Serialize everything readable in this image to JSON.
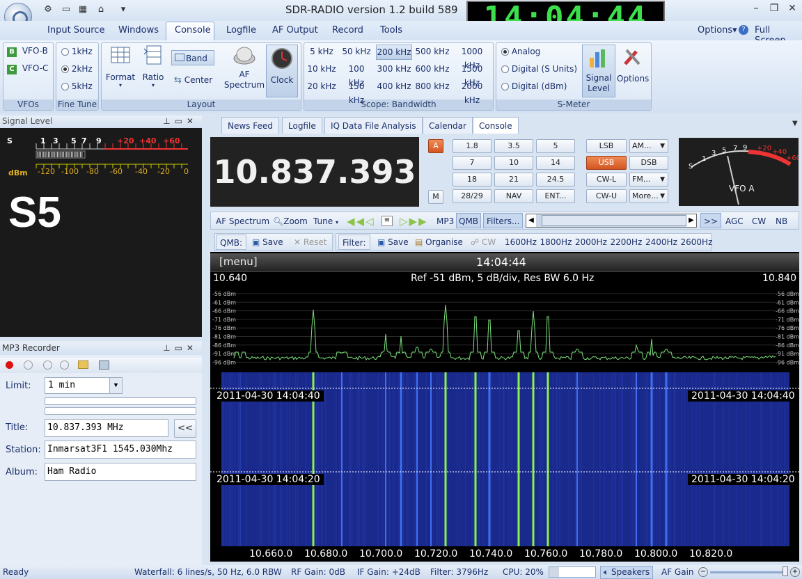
{
  "app": {
    "title": "SDR-RADIO version 1.2  build 589",
    "clock": "14:04:44"
  },
  "menu": {
    "items": [
      "Input Source",
      "Windows",
      "Console",
      "Logfile",
      "AF Output",
      "Record",
      "Tools"
    ],
    "options": "Options",
    "fullscreen": "Full Screen"
  },
  "ribbon": {
    "vfo": {
      "b": "VFO-B",
      "c": "VFO-C",
      "caption": "VFOs"
    },
    "finetune": {
      "options": [
        "1kHz",
        "2kHz",
        "5kHz"
      ],
      "selected": "2kHz",
      "caption": "Fine Tune"
    },
    "layout": {
      "format": "Format",
      "ratio": "Ratio",
      "band": "Band",
      "center": "Center",
      "af": "AF Spectrum",
      "clock": "Clock",
      "caption": "Layout"
    },
    "bandwidth": {
      "items": [
        "5 kHz",
        "50 kHz",
        "200 kHz",
        "500 kHz",
        "1000 kHz",
        "10 kHz",
        "100 kHz",
        "300 kHz",
        "600 kHz",
        "1500 kHz",
        "20 kHz",
        "150 kHz",
        "400 kHz",
        "800 kHz",
        "2000 kHz"
      ],
      "selected": "200 kHz",
      "caption": "Scope: Bandwidth"
    },
    "smeter": {
      "options": [
        "Analog",
        "Digital (S Units)",
        "Digital (dBm)"
      ],
      "selected": "Analog",
      "signal": "Signal Level",
      "opts": "Options",
      "caption": "S-Meter"
    }
  },
  "signal_panel": {
    "title": "Signal Level",
    "reading": "S5",
    "units": "dBm",
    "s_scale": [
      "S",
      "1",
      "3",
      "5",
      "7",
      "9",
      "+20",
      "+40",
      "+60"
    ],
    "dbm_scale": [
      "-120",
      "-100",
      "-80",
      "-60",
      "-40",
      "-20",
      "0"
    ]
  },
  "mp3": {
    "title": "MP3 Recorder",
    "limit_label": "Limit:",
    "limit": "1 min",
    "title_label": "Title:",
    "title_value": "10.837.393 MHz",
    "station_label": "Station:",
    "station": "Inmarsat3F1 1545.030Mhz",
    "album_label": "Album:",
    "album": "Ham Radio",
    "back": "<<"
  },
  "tabs": [
    "News Feed",
    "Logfile",
    "IQ Data File Analysis",
    "Calendar",
    "Console"
  ],
  "active_tab": "Console",
  "console": {
    "frequency": "10.837.393",
    "a": "A",
    "m": "M",
    "bands": [
      "1.8",
      "3.5",
      "5",
      "7",
      "10",
      "14",
      "18",
      "21",
      "24.5",
      "28/29",
      "NAV",
      "ENT..."
    ],
    "modes": [
      "LSB",
      "AM...",
      "USB",
      "DSB",
      "CW-L",
      "FM...",
      "CW-U",
      "More..."
    ],
    "active_mode": "USB",
    "meter_label": "VFO A",
    "meter_scale": [
      "S",
      "1",
      "3",
      "5",
      "7",
      "9",
      "+20",
      "+40",
      "+60"
    ]
  },
  "toolbar1": {
    "af": "AF Spectrum",
    "zoom": "Zoom",
    "tune": "Tune",
    "mp3": "MP3",
    "qmb": "QMB",
    "filters": "Filters...",
    "more": ">>",
    "agc": "AGC",
    "cw": "CW",
    "nb": "NB"
  },
  "toolbar2": {
    "qmb": "QMB:",
    "save": "Save",
    "reset": "Reset",
    "filter": "Filter:",
    "save2": "Save",
    "organise": "Organise",
    "cw": "CW",
    "filters": [
      "1600Hz",
      "1800Hz",
      "2000Hz",
      "2200Hz",
      "2400Hz",
      "2600Hz"
    ]
  },
  "spectrum": {
    "menu": "[menu]",
    "time": "14:04:44",
    "left_freq": "10.640",
    "right_freq": "10.840",
    "info": "Ref -51 dBm,  5 dB/div,  Res BW 6.0 Hz",
    "db_labels": [
      "-56 dBm",
      "-61 dBm",
      "-66 dBm",
      "-71 dBm",
      "-76 dBm",
      "-81 dBm",
      "-86 dBm",
      "-91 dBm",
      "-96 dBm"
    ],
    "stamps": [
      "2011-04-30  14:04:40",
      "2011-04-30  14:04:20"
    ],
    "axis": [
      "10.660.0",
      "10.680.0",
      "10.700.0",
      "10.720.0",
      "10.740.0",
      "10.760.0",
      "10.780.0",
      "10.800.0",
      "10.820.0"
    ]
  },
  "status": {
    "ready": "Ready",
    "waterfall": "Waterfall: 6 lines/s, 50 Hz, 6.0 RBW",
    "rf": "RF Gain: 0dB",
    "if": "IF Gain: +24dB",
    "filter": "Filter: 3796Hz",
    "cpu": "CPU: 20%",
    "speakers": "Speakers",
    "afgain": "AF Gain"
  }
}
